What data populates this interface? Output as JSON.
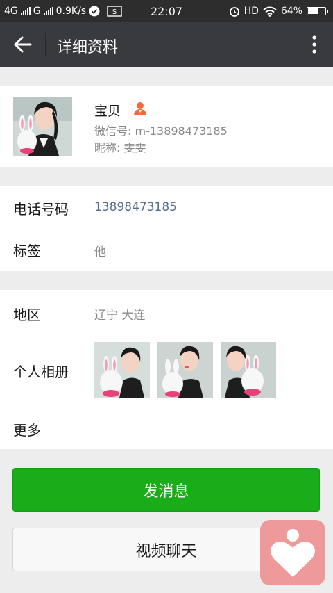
{
  "status_bar": {
    "net1": "4G",
    "net2": "G",
    "speed": "0.9K/s",
    "time": "22:07",
    "hd": "HD",
    "battery": "64%",
    "battery_level": 0.64
  },
  "header": {
    "title": "详细资料"
  },
  "profile": {
    "name": "宝贝",
    "wechat_id": "微信号: m-13898473185",
    "nickname": "昵称: 雯雯"
  },
  "info": {
    "phone_label": "电话号码",
    "phone_value": "13898473185",
    "tag_label": "标签",
    "tag_value": "他",
    "region_label": "地区",
    "region_value": "辽宁 大连",
    "album_label": "个人相册",
    "more_label": "更多"
  },
  "actions": {
    "send_message": "发消息",
    "video_chat": "视频聊天"
  },
  "colors": {
    "accent_green": "#1aad19",
    "link_blue": "#576b95",
    "appbar": "#393a3f",
    "statusbar": "#2d2d2d"
  },
  "icons": [
    "signal-icon",
    "check-icon",
    "screenshot-icon",
    "alarm-icon",
    "wifi-icon",
    "battery-icon",
    "back-arrow-icon",
    "more-vert-icon",
    "person-icon",
    "heart-app-icon"
  ]
}
